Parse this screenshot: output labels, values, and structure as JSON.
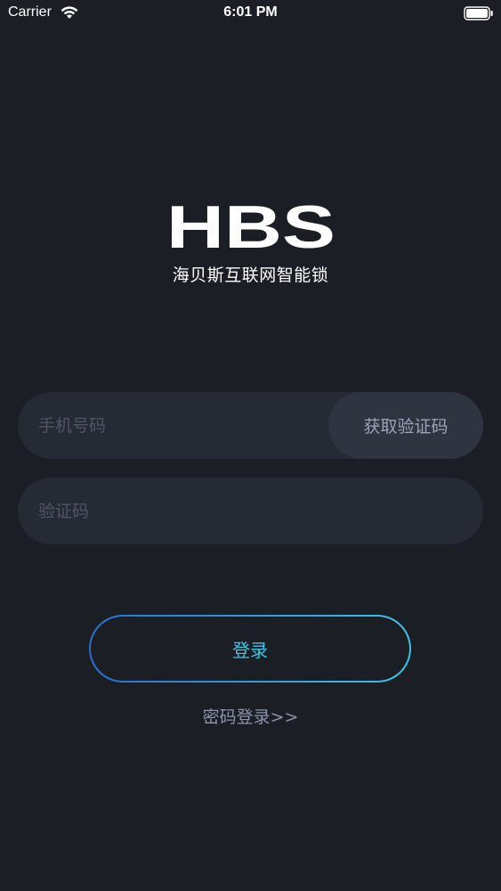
{
  "status_bar": {
    "carrier": "Carrier",
    "time": "6:01 PM",
    "wifi_icon": "wifi-icon",
    "battery_icon": "battery-full-icon"
  },
  "brand": {
    "logo_text": "HBS",
    "subtitle": "海贝斯互联网智能锁"
  },
  "form": {
    "phone_placeholder": "手机号码",
    "phone_value": "",
    "get_code_label": "获取验证码",
    "code_placeholder": "验证码",
    "code_value": ""
  },
  "actions": {
    "login_label": "登录",
    "password_login_label": "密码登录>>"
  },
  "colors": {
    "background": "#1c1e25",
    "input_bg": "#262a35",
    "code_button_bg": "#2f3441",
    "accent": "#3ec6e8",
    "accent_gradient_start": "#2a6fd0",
    "link": "#8d94ab"
  }
}
